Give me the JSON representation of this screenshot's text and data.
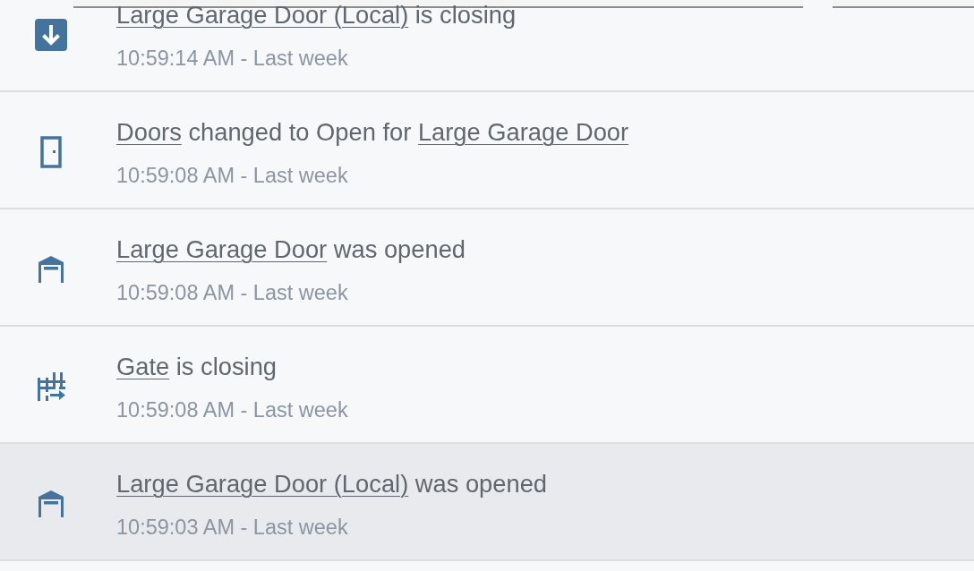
{
  "entries": [
    {
      "kind": "closing",
      "selected": false,
      "message": [
        {
          "text": "Large Garage Door (Local)",
          "link": true
        },
        {
          "text": " is closing",
          "link": false
        }
      ],
      "time": "10:59:14 AM - Last week"
    },
    {
      "kind": "door",
      "selected": false,
      "message": [
        {
          "text": "Doors",
          "link": true
        },
        {
          "text": " changed to Open for ",
          "link": false
        },
        {
          "text": "Large Garage Door",
          "link": true
        }
      ],
      "time": "10:59:08 AM - Last week"
    },
    {
      "kind": "garage",
      "selected": false,
      "message": [
        {
          "text": "Large Garage Door",
          "link": true
        },
        {
          "text": " was opened",
          "link": false
        }
      ],
      "time": "10:59:08 AM - Last week"
    },
    {
      "kind": "gate",
      "selected": false,
      "message": [
        {
          "text": "Gate",
          "link": true
        },
        {
          "text": " is closing",
          "link": false
        }
      ],
      "time": "10:59:08 AM - Last week"
    },
    {
      "kind": "garage",
      "selected": true,
      "message": [
        {
          "text": "Large Garage Door (Local)",
          "link": true
        },
        {
          "text": " was opened",
          "link": false
        }
      ],
      "time": "10:59:03 AM - Last week"
    }
  ]
}
